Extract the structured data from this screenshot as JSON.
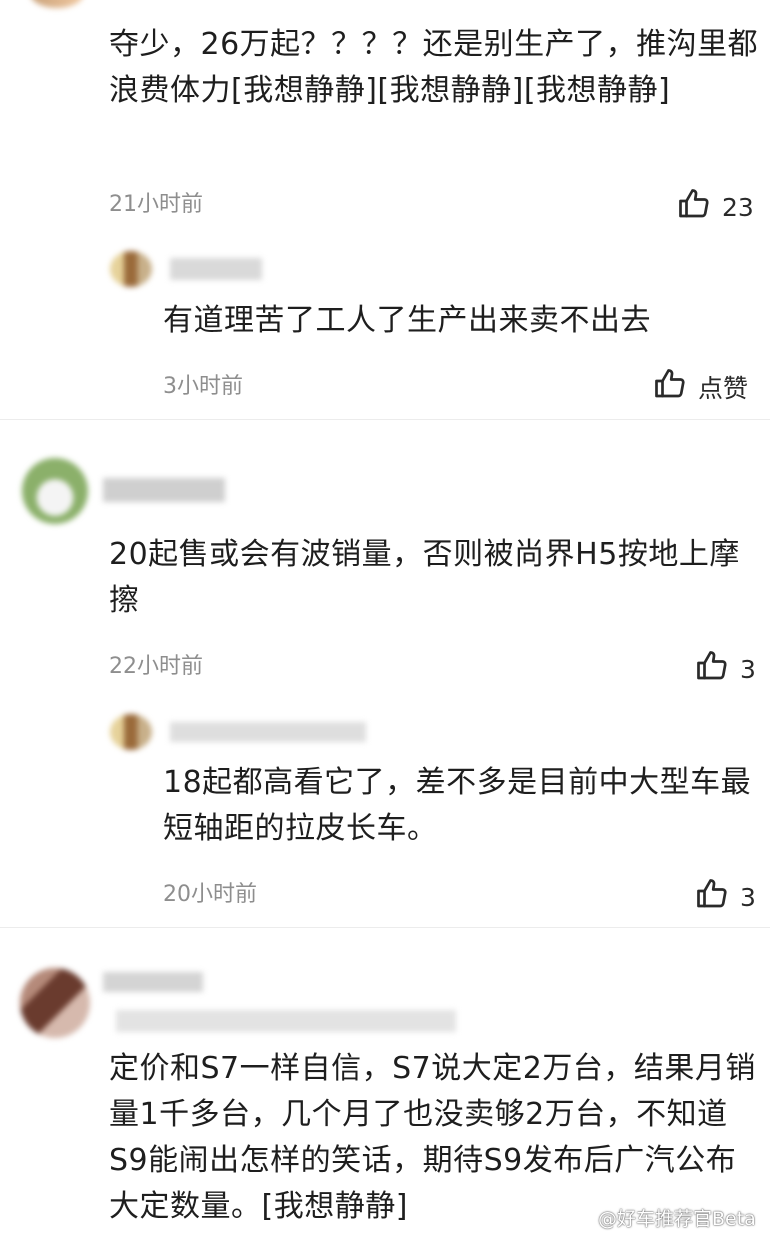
{
  "comments": [
    {
      "text": "夺少，26万起？？？？还是别生产了，推沟里都浪费体力[我想静静][我想静静][我想静静]",
      "time": "21小时前",
      "likes": "23",
      "reply": {
        "text": "有道理苦了工人了生产出来卖不出去",
        "time": "3小时前",
        "likes": "点赞"
      }
    },
    {
      "text": "20起售或会有波销量，否则被尚界H5按地上摩擦",
      "time": "22小时前",
      "likes": "3",
      "reply": {
        "text": "18起都高看它了，差不多是目前中大型车最短轴距的拉皮长车。",
        "time": "20小时前",
        "likes": "3"
      }
    },
    {
      "text": "定价和S7一样自信，S7说大定2万台，结果月销量1千多台，几个月了也没卖够2万台，不知道S9能闹出怎样的笑话，期待S9发布后广汽公布大定数量。[我想静静]"
    }
  ],
  "watermark": "@好车推荐官Beta",
  "colors": {
    "text": "#1e1e1e",
    "muted": "#8e8e8e",
    "divider": "#ececec"
  },
  "icons": {
    "like": "thumbs-up-icon"
  }
}
